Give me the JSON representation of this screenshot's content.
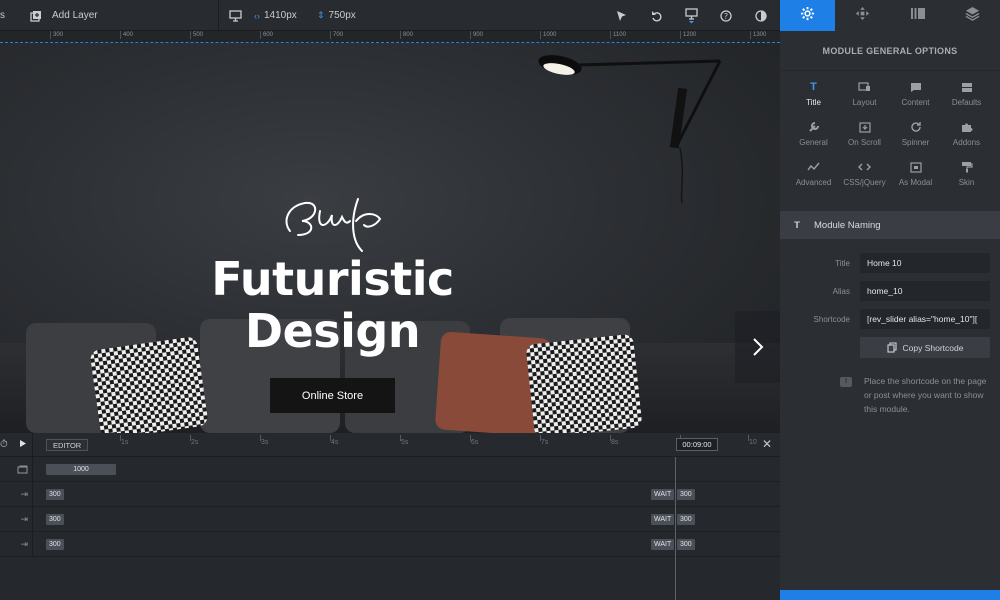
{
  "toolbar": {
    "add_layer_label": "Add Layer",
    "width_value": "1410px",
    "height_value": "750px",
    "left_cut_char": "s"
  },
  "right_tabs": [
    {
      "name": "settings",
      "active": true
    },
    {
      "name": "navigation",
      "active": false
    },
    {
      "name": "slides",
      "active": false
    },
    {
      "name": "layers",
      "active": false
    }
  ],
  "ruler": {
    "ticks": [
      "300",
      "400",
      "500",
      "600",
      "700",
      "800",
      "900",
      "1000",
      "1100",
      "1200",
      "1300"
    ]
  },
  "canvas": {
    "headline_line1": "Futuristic",
    "headline_line2": "Design",
    "cta_label": "Online Store"
  },
  "panel": {
    "title": "MODULE GENERAL OPTIONS",
    "options": [
      {
        "label": "Title",
        "icon": "title-icon"
      },
      {
        "label": "Layout",
        "icon": "layout-icon"
      },
      {
        "label": "Content",
        "icon": "content-icon"
      },
      {
        "label": "Defaults",
        "icon": "defaults-icon"
      },
      {
        "label": "General",
        "icon": "wrench-icon"
      },
      {
        "label": "On Scroll",
        "icon": "on-scroll-icon"
      },
      {
        "label": "Spinner",
        "icon": "spinner-icon"
      },
      {
        "label": "Addons",
        "icon": "puzzle-icon"
      },
      {
        "label": "Advanced",
        "icon": "advanced-icon"
      },
      {
        "label": "CSS/jQuery",
        "icon": "code-icon"
      },
      {
        "label": "As Modal",
        "icon": "modal-icon"
      },
      {
        "label": "Skin",
        "icon": "paint-roller-icon"
      }
    ],
    "section_icon_char": "T",
    "section_title": "Module Naming",
    "fields": {
      "title_label": "Title",
      "title_value": "Home 10",
      "alias_label": "Alias",
      "alias_value": "home_10",
      "shortcode_label": "Shortcode",
      "shortcode_value": "[rev_slider alias=\"home_10\"][",
      "copy_label": "Copy Shortcode"
    },
    "hint": "Place the shortcode on the page or post where you want to show this module."
  },
  "timeline": {
    "editor_label": "EDITOR",
    "seconds": [
      "1s",
      "2s",
      "3s",
      "4s",
      "5s",
      "6s",
      "7s",
      "8s",
      "9s",
      "10"
    ],
    "time": "00:09:00",
    "slide_chip": "1000",
    "layer_rows": [
      {
        "start": "300",
        "wait": "WAIT",
        "end": "300"
      },
      {
        "start": "300",
        "wait": "WAIT",
        "end": "300"
      },
      {
        "start": "300",
        "wait": "WAIT",
        "end": "300"
      }
    ]
  },
  "colors": {
    "accent": "#1e7fe6",
    "panel_bg": "#2b2e33",
    "canvas_bg": "#2c2f33"
  }
}
